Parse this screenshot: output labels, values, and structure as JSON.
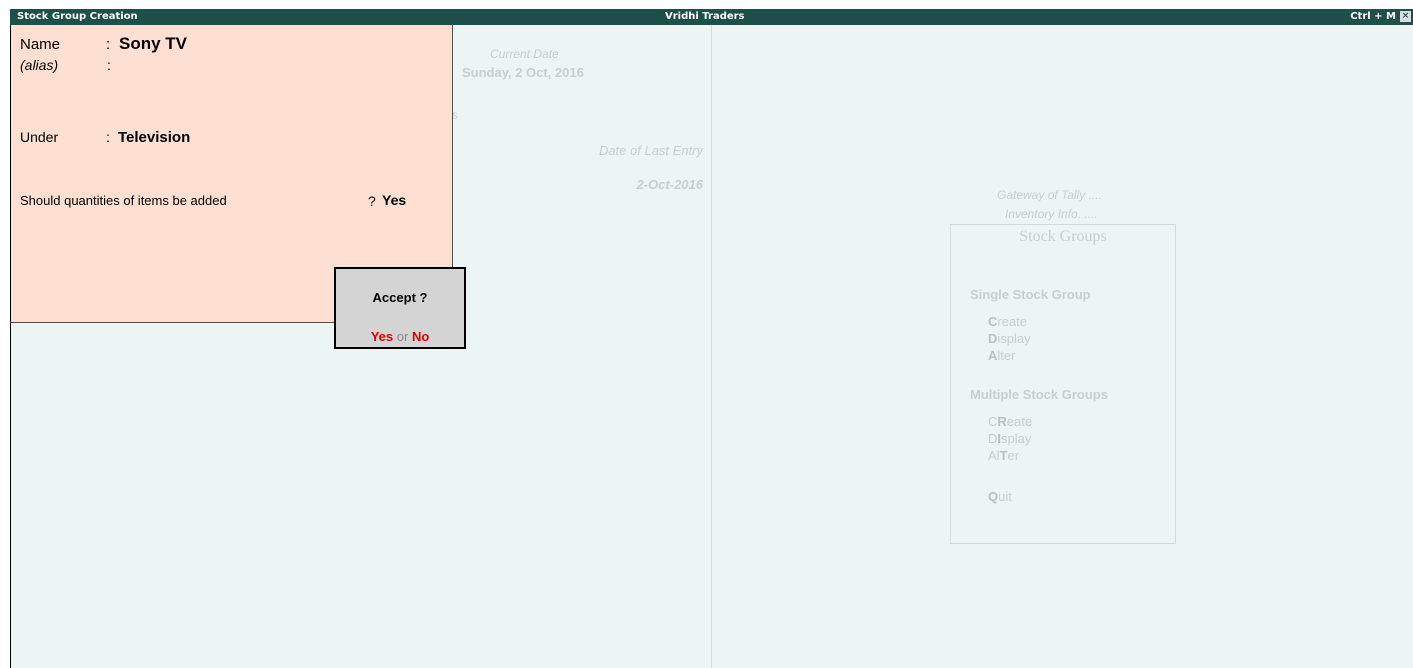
{
  "titlebar": {
    "screen_title": "Stock Group Creation",
    "company": "Vridhi Traders",
    "shortcut": "Ctrl + M",
    "close_glyph": "×"
  },
  "background_info": {
    "current_date_label": "Current Date",
    "current_date": "Sunday, 2 Oct, 2016",
    "stray_char": "s",
    "last_entry_label": "Date of Last Entry",
    "last_entry_date": "2-Oct-2016"
  },
  "gateway": {
    "line1": "Gateway of Tally ....",
    "line2": "Inventory Info. ...."
  },
  "menu": {
    "title": "Stock Groups",
    "single_section": "Single Stock Group",
    "single_items": [
      {
        "key": "C",
        "rest": "reate"
      },
      {
        "key": "D",
        "rest": "isplay"
      },
      {
        "key": "A",
        "rest": "lter"
      }
    ],
    "multiple_section": "Multiple Stock Groups",
    "multiple_items": [
      {
        "pre": "C",
        "key": "R",
        "rest": "eate"
      },
      {
        "pre": "D",
        "key": "I",
        "rest": "splay"
      },
      {
        "pre": "Al",
        "key": "T",
        "rest": "er"
      }
    ],
    "quit": {
      "key": "Q",
      "rest": "uit"
    }
  },
  "form": {
    "name_label": "Name",
    "name_value": "Sony TV",
    "alias_label": "(alias)",
    "under_label": "Under",
    "under_value": "Television",
    "question": "Should quantities of items be added",
    "question_mark": "?",
    "question_value": "Yes",
    "colon": ":"
  },
  "accept_dialog": {
    "title": "Accept ?",
    "yes_label": "Yes",
    "or_label": "or",
    "no_label": "No"
  }
}
